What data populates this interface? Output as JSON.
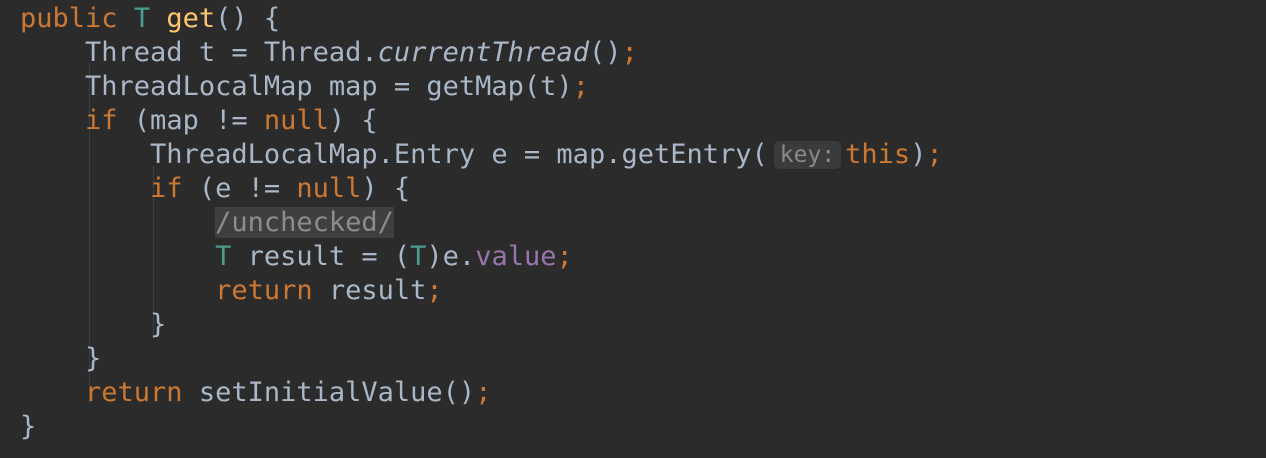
{
  "code": {
    "l1": {
      "kw": "public",
      "type": "T",
      "fn": "get",
      "rest": "() {"
    },
    "l2": {
      "a": "Thread t = Thread.",
      "b": "currentThread",
      "c": "()",
      "semi": ";"
    },
    "l3": {
      "a": "ThreadLocalMap map = getMap(t)",
      "semi": ";"
    },
    "l4": {
      "kw": "if",
      "a": " (map != ",
      "kw2": "null",
      "b": ") {"
    },
    "l5": {
      "a": "ThreadLocalMap.Entry e = map.getEntry(",
      "hint": "key:",
      "kw": "this",
      "b": ")",
      "semi": ";"
    },
    "l6": {
      "kw": "if",
      "a": " (e != ",
      "kw2": "null",
      "b": ") {"
    },
    "l7": {
      "comment": "/unchecked/"
    },
    "l8": {
      "type": "T",
      "a": " result = (",
      "type2": "T",
      "b": ")e.",
      "fld": "value",
      "semi": ";"
    },
    "l9": {
      "kw": "return",
      "a": " result",
      "semi": ";"
    },
    "l10": {
      "a": "}"
    },
    "l11": {
      "a": "}"
    },
    "l12": {
      "kw": "return",
      "a": " setInitialValue()",
      "semi": ";"
    },
    "l13": {
      "a": "}"
    }
  },
  "colors": {
    "background": "#2b2b2c",
    "keyword": "#cc7832",
    "type": "#4a9e8e",
    "method": "#ffc66d",
    "field": "#9876aa",
    "text": "#a9b7c6"
  }
}
